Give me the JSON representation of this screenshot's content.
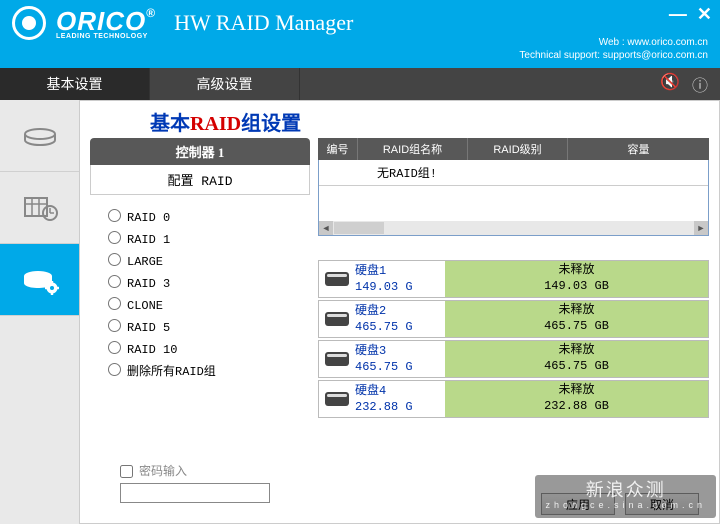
{
  "header": {
    "brand": "ORICO",
    "brand_sub": "LEADING TECHNOLOGY",
    "app_title": "HW RAID Manager",
    "web_label": "Web : www.orico.com.cn",
    "support_label": "Technical support: supports@orico.com.cn"
  },
  "tabs": {
    "basic": "基本设置",
    "advanced": "高级设置"
  },
  "section_title_prefix": "基本",
  "section_title_red": "RAID",
  "section_title_suffix": "组设置",
  "controller_bar": "控制器 1",
  "configure_head": "配置 RAID",
  "raid_options": [
    "RAID 0",
    "RAID 1",
    "LARGE",
    "RAID 3",
    "CLONE",
    "RAID 5",
    "RAID 10",
    "删除所有RAID组"
  ],
  "grid_headers": {
    "c1": "编号",
    "c2": "RAID组名称",
    "c3": "RAID级别",
    "c4": "容量"
  },
  "no_raid_text": "无RAID组!",
  "disks": [
    {
      "name": "硬盘1",
      "size": "149.03 G",
      "status": "未释放",
      "status_size": "149.03 GB"
    },
    {
      "name": "硬盘2",
      "size": "465.75 G",
      "status": "未释放",
      "status_size": "465.75 GB"
    },
    {
      "name": "硬盘3",
      "size": "465.75 G",
      "status": "未释放",
      "status_size": "465.75 GB"
    },
    {
      "name": "硬盘4",
      "size": "232.88 G",
      "status": "未释放",
      "status_size": "232.88 GB"
    }
  ],
  "password_label": "密码输入",
  "buttons": {
    "apply": "应用",
    "cancel": "取消"
  },
  "watermark": {
    "line1": "新浪众测",
    "line2": "zhongce.sina.com.cn"
  }
}
